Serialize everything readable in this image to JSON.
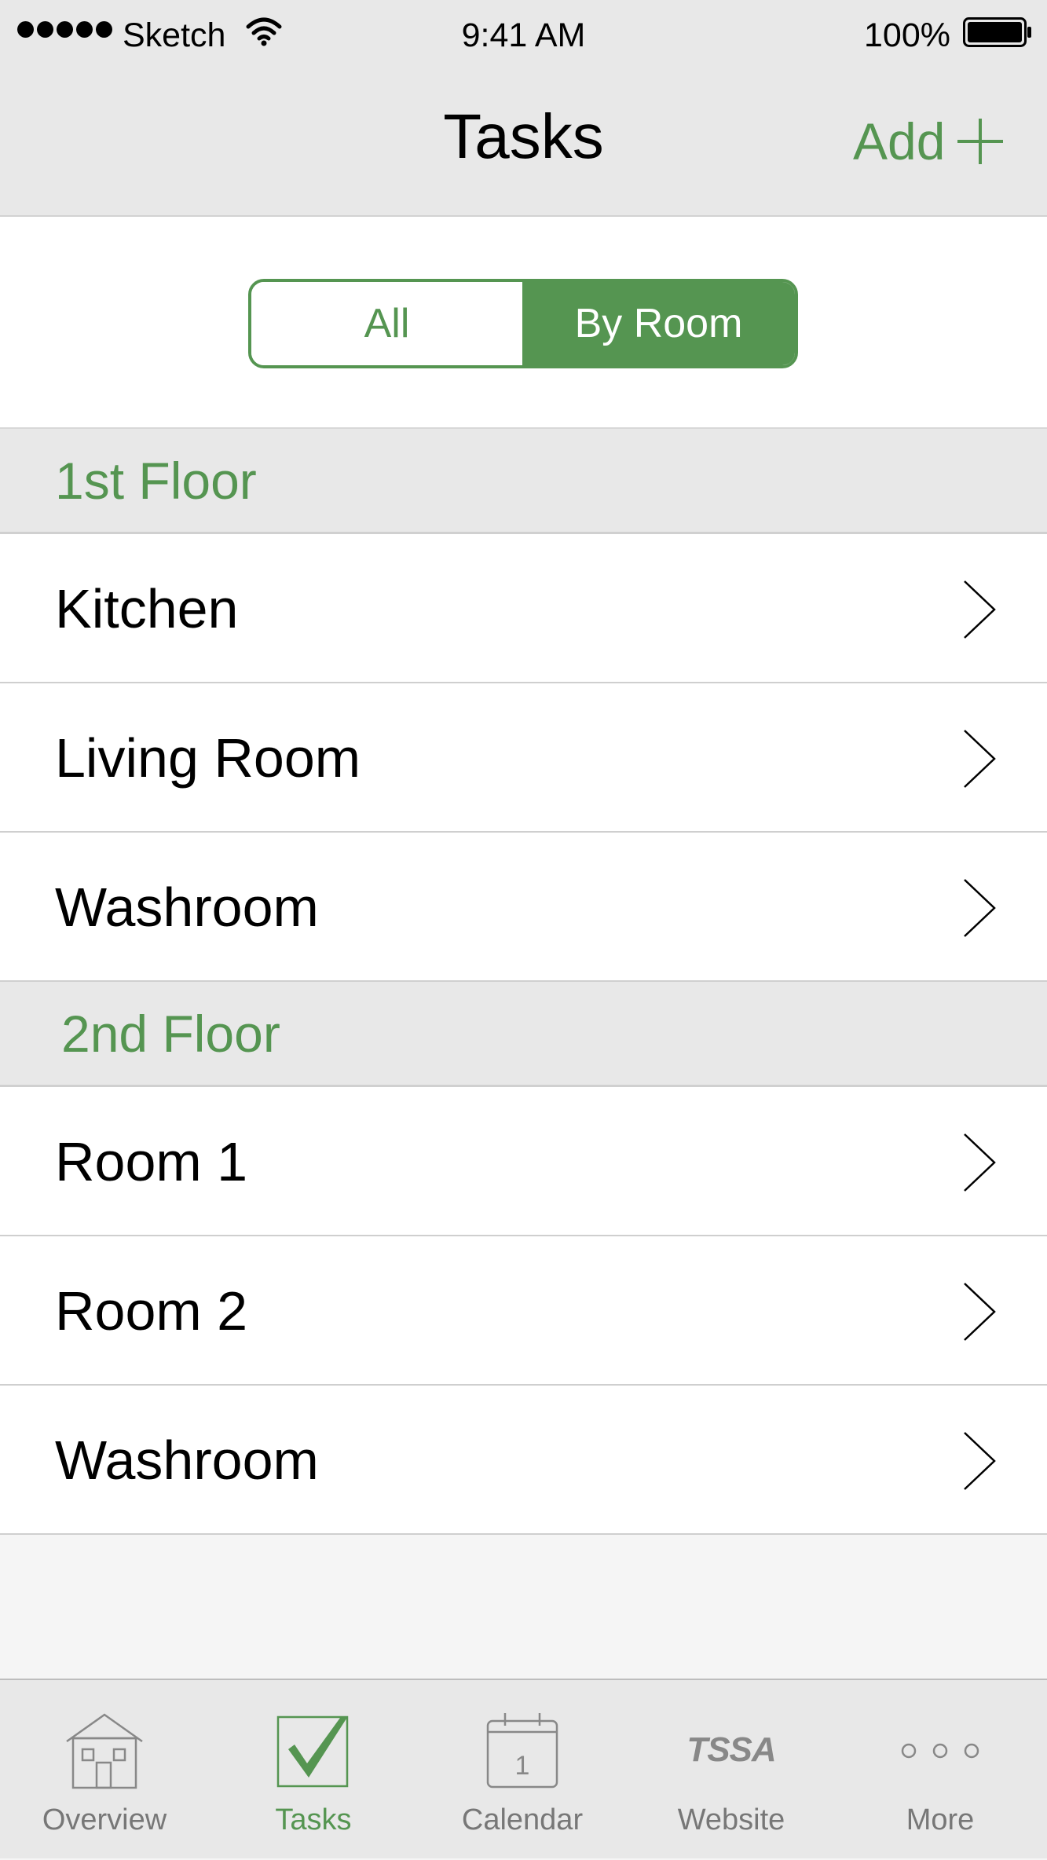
{
  "status_bar": {
    "carrier": "Sketch",
    "time": "9:41 AM",
    "battery": "100%",
    "icons": [
      "signal-icon",
      "wifi-icon",
      "battery-icon"
    ]
  },
  "nav": {
    "title": "Tasks",
    "add_label": "Add",
    "add_icon": "plus-icon"
  },
  "segmented": {
    "options": [
      "All",
      "By Room"
    ],
    "selected": "By Room"
  },
  "sections": [
    {
      "title": "1st Floor",
      "rows": [
        "Kitchen",
        "Living Room",
        "Washroom"
      ]
    },
    {
      "title": "2nd Floor",
      "rows": [
        "Room 1",
        "Room 2",
        "Washroom"
      ]
    }
  ],
  "tab_bar": {
    "tabs": [
      {
        "label": "Overview",
        "icon": "house-icon"
      },
      {
        "label": "Tasks",
        "icon": "checkbox-icon"
      },
      {
        "label": "Calendar",
        "icon": "calendar-icon",
        "icon_text": "1"
      },
      {
        "label": "Website",
        "icon": "tssa-logo-icon",
        "icon_text": "TSSA"
      },
      {
        "label": "More",
        "icon": "more-icon"
      }
    ],
    "active": "Tasks"
  },
  "colors": {
    "accent": "#559551",
    "bar_background": "#e8e8e8",
    "list_background": "#ffffff",
    "inactive_tab": "#777777"
  }
}
